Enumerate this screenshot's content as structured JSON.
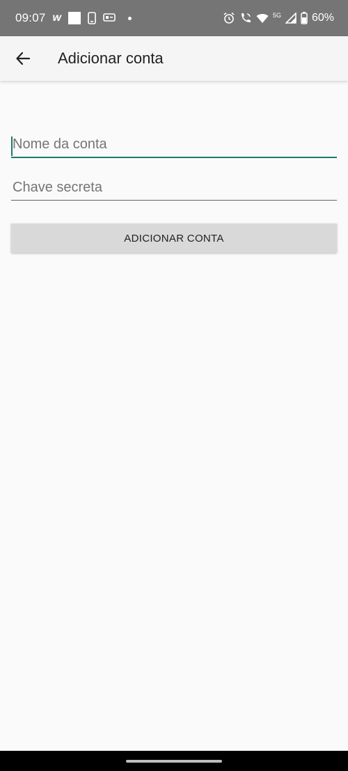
{
  "status_bar": {
    "time": "09:07",
    "app_letter": "w",
    "battery": "60%",
    "network_label": "5G",
    "icons": [
      "square-notification-icon",
      "phone-icon",
      "message-icon",
      "alarm-icon",
      "wifi-call-icon",
      "wifi-icon",
      "signal-icon",
      "battery-icon"
    ]
  },
  "app_bar": {
    "title": "Adicionar conta",
    "back_icon": "arrow-back-icon"
  },
  "form": {
    "account_name_placeholder": "Nome da conta",
    "account_name_value": "",
    "secret_key_placeholder": "Chave secreta",
    "secret_key_value": "",
    "submit_label": "ADICIONAR CONTA"
  },
  "colors": {
    "accent": "#1a7a6e",
    "status_bar": "#757575",
    "button_bg": "#d8d9d8",
    "background": "#fafafa"
  }
}
